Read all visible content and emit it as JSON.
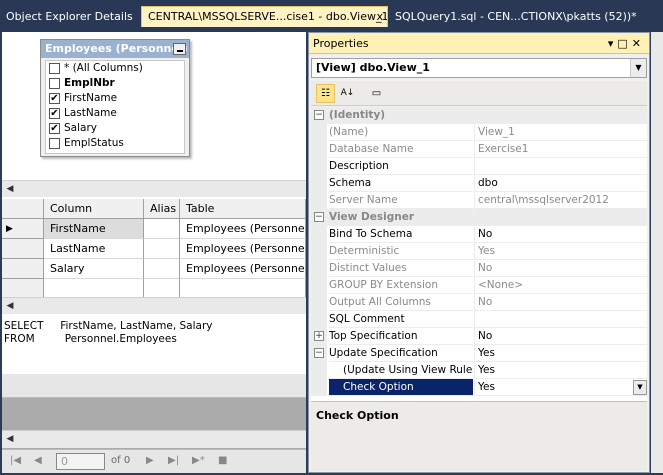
{
  "tabs": [
    {
      "label": "Object Explorer Details",
      "active": false
    },
    {
      "label": "CENTRAL\\MSSQLSERVE...cise1 - dbo.View_1*",
      "active": true,
      "close": "x"
    },
    {
      "label": "SQLQuery1.sql - CEN...CTIONX\\pkatts (52))*",
      "active": false
    }
  ],
  "diagram": {
    "table_title": "Employees (Personnel)",
    "columns": [
      {
        "label": "* (All Columns)",
        "checked": false,
        "bold": false
      },
      {
        "label": "EmplNbr",
        "checked": false,
        "bold": true
      },
      {
        "label": "FirstName",
        "checked": true,
        "bold": false
      },
      {
        "label": "LastName",
        "checked": true,
        "bold": false
      },
      {
        "label": "Salary",
        "checked": true,
        "bold": false
      },
      {
        "label": "EmplStatus",
        "checked": false,
        "bold": false
      }
    ]
  },
  "grid": {
    "headers": [
      "Column",
      "Alias",
      "Table"
    ],
    "rows": [
      {
        "column": "FirstName",
        "alias": "",
        "table": "Employees (Personnel)"
      },
      {
        "column": "LastName",
        "alias": "",
        "table": "Employees (Personnel)"
      },
      {
        "column": "Salary",
        "alias": "",
        "table": "Employees (Personnel)"
      }
    ]
  },
  "sql": {
    "line1": "SELECT     FirstName, LastName, Salary",
    "line2": "FROM         Personnel.Employees"
  },
  "results_nav": {
    "record_value": "0",
    "of_label": "of 0"
  },
  "properties": {
    "title": "Properties",
    "object": "[View] dbo.View_1",
    "rows": [
      {
        "kind": "cat",
        "name": "(Identity)",
        "value": "",
        "expander": "−"
      },
      {
        "kind": "ro",
        "name": "(Name)",
        "value": "View_1"
      },
      {
        "kind": "ro",
        "name": "Database Name",
        "value": "Exercise1"
      },
      {
        "kind": "rw",
        "name": "Description",
        "value": ""
      },
      {
        "kind": "rw",
        "name": "Schema",
        "value": "dbo"
      },
      {
        "kind": "ro",
        "name": "Server Name",
        "value": "central\\mssqlserver2012"
      },
      {
        "kind": "cat",
        "name": "View Designer",
        "value": "",
        "expander": "−"
      },
      {
        "kind": "rw",
        "name": "Bind To Schema",
        "value": "No"
      },
      {
        "kind": "ro",
        "name": "Deterministic",
        "value": "Yes"
      },
      {
        "kind": "ro",
        "name": "Distinct Values",
        "value": "No"
      },
      {
        "kind": "ro",
        "name": "GROUP BY Extension",
        "value": "<None>"
      },
      {
        "kind": "ro",
        "name": "Output All Columns",
        "value": "No"
      },
      {
        "kind": "rw",
        "name": "SQL Comment",
        "value": ""
      },
      {
        "kind": "rw",
        "name": "Top Specification",
        "value": "No",
        "expander": "+"
      },
      {
        "kind": "rw",
        "name": "Update Specification",
        "value": "Yes",
        "expander": "−"
      },
      {
        "kind": "sub",
        "name": "(Update Using View Rules)",
        "value": "Yes"
      },
      {
        "kind": "selected",
        "name": "Check Option",
        "value": "Yes"
      }
    ],
    "description_title": "Check Option"
  }
}
